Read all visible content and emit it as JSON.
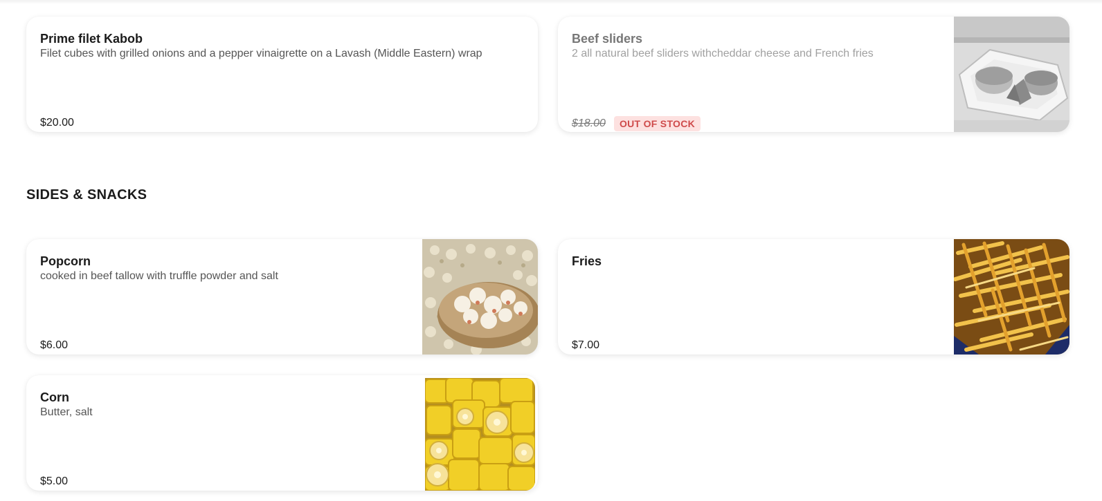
{
  "sections": {
    "sides_snacks_title": "SIDES & SNACKS"
  },
  "items": {
    "kabob": {
      "name": "Prime filet Kabob",
      "description": "Filet cubes with grilled onions and a pepper vinaigrette on a Lavash (Middle Eastern) wrap",
      "price": "$20.00"
    },
    "sliders": {
      "name": "Beef sliders",
      "description": "2 all natural beef sliders withcheddar cheese and French fries",
      "price": "$18.00",
      "badge": "OUT OF STOCK",
      "image_icon": "slider-food-photo"
    },
    "popcorn": {
      "name": "Popcorn",
      "description": "cooked in beef tallow with truffle powder and salt",
      "price": "$6.00",
      "image_icon": "popcorn-photo"
    },
    "fries": {
      "name": "Fries",
      "price": "$7.00",
      "image_icon": "fries-photo"
    },
    "corn": {
      "name": "Corn",
      "description": "Butter, salt",
      "price": "$5.00",
      "image_icon": "corn-photo"
    }
  },
  "colors": {
    "card_background": "#ffffff",
    "badge_text": "#cf4b4b",
    "badge_background": "#fde1e0",
    "muted_text": "#a0a0a0"
  }
}
